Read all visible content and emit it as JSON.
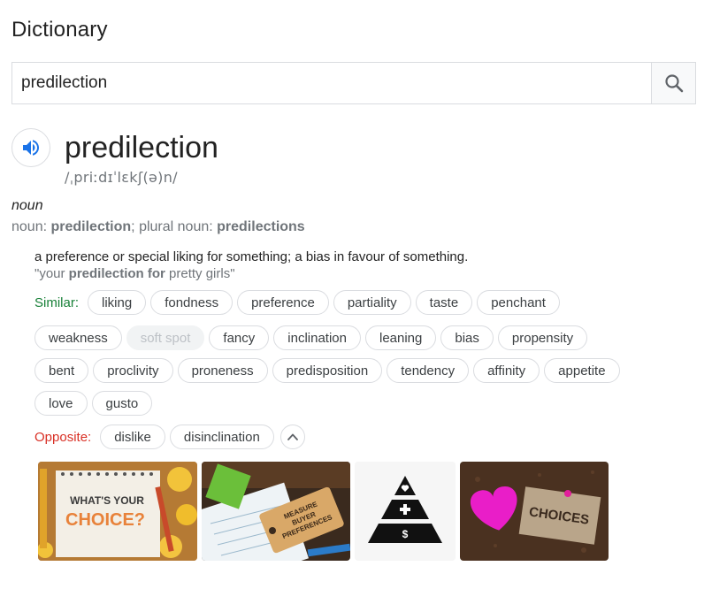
{
  "header": {
    "title": "Dictionary"
  },
  "search": {
    "value": "predilection"
  },
  "entry": {
    "word": "predilection",
    "phonetic": "/ˌpriːdɪˈlɛkʃ(ə)n/",
    "part_of_speech": "noun",
    "forms": {
      "noun_label": "noun: ",
      "noun": "predilection",
      "sep": "; ",
      "plural_label": "plural noun: ",
      "plural": "predilections"
    },
    "definition": "a preference or special liking for something; a bias in favour of something.",
    "example": {
      "open": "\"your ",
      "bold": "predilection for",
      "close": " pretty girls\""
    }
  },
  "similar": {
    "label": "Similar:",
    "rows": [
      [
        "liking",
        "fondness",
        "preference",
        "partiality",
        "taste",
        "penchant"
      ],
      [
        "weakness",
        "soft spot",
        "fancy",
        "inclination",
        "leaning",
        "bias",
        "propensity"
      ],
      [
        "bent",
        "proclivity",
        "proneness",
        "predisposition",
        "tendency",
        "affinity",
        "appetite"
      ],
      [
        "love",
        "gusto"
      ]
    ],
    "disabled": [
      "soft spot"
    ]
  },
  "opposite": {
    "label": "Opposite:",
    "words": [
      "dislike",
      "disinclination"
    ]
  },
  "images": {
    "img1_text": [
      "WHAT'S YOUR",
      "CHOICE?"
    ],
    "img2_text": [
      "MEASURE",
      "BUYER",
      "PREFERENCES"
    ],
    "img4_text": "CHOICES"
  },
  "colors": {
    "similar": "#188038",
    "opposite": "#d93025",
    "speaker": "#1a73e8",
    "muted": "#70757a"
  },
  "icons": {
    "search": "search-icon",
    "speaker": "volume-up-icon",
    "collapse": "chevron-up-icon"
  }
}
